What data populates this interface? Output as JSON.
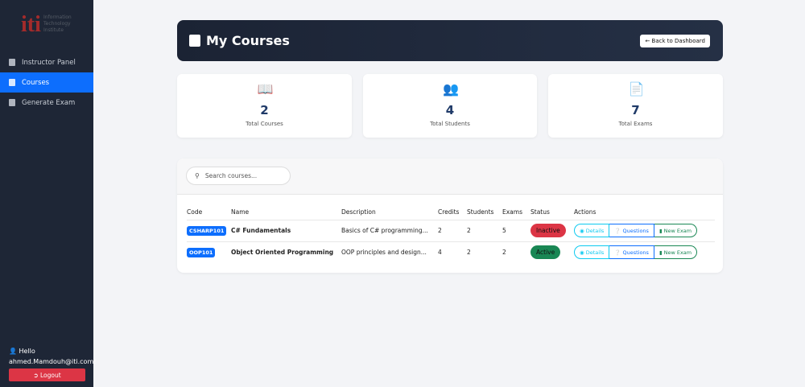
{
  "sidebar": {
    "logo_text": "Information Technology Institute",
    "logo_mark": "iti",
    "items": [
      {
        "label": "Instructor Panel"
      },
      {
        "label": "Courses"
      },
      {
        "label": "Generate Exam"
      }
    ],
    "greeting": "Hello",
    "email": "ahmed.Mamdouh@iti.com!",
    "logout": "Logout"
  },
  "header": {
    "title": "My Courses",
    "back": "Back to Dashboard"
  },
  "stats": [
    {
      "value": "2",
      "label": "Total Courses",
      "icon": "book-open-icon"
    },
    {
      "value": "4",
      "label": "Total Students",
      "icon": "users-icon"
    },
    {
      "value": "7",
      "label": "Total Exams",
      "icon": "file-icon"
    }
  ],
  "search": {
    "placeholder": "Search courses..."
  },
  "table": {
    "headers": [
      "Code",
      "Name",
      "Description",
      "Credits",
      "Students",
      "Exams",
      "Status",
      "Actions"
    ],
    "rows": [
      {
        "code": "CSHARP101",
        "name": "C# Fundamentals",
        "description": "Basics of C# programming...",
        "credits": "2",
        "students": "2",
        "exams": "5",
        "status": "Inactive"
      },
      {
        "code": "OOP101",
        "name": "Object Oriented Programming",
        "description": "OOP principles and design...",
        "credits": "4",
        "students": "2",
        "exams": "2",
        "status": "Active"
      }
    ],
    "actions": {
      "details": "Details",
      "questions": "Questions",
      "new_exam": "New Exam"
    }
  },
  "colors": {
    "inactive": "#dc3545",
    "active": "#198754",
    "primary": "#0d6efd"
  }
}
